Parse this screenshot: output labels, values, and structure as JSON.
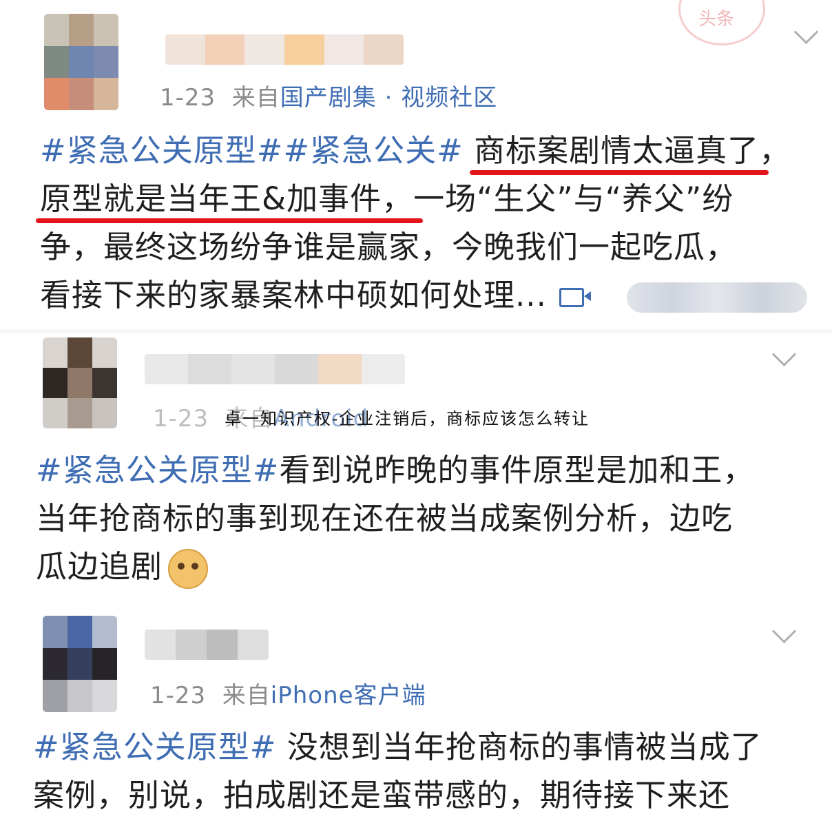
{
  "posts": [
    {
      "date": "1-23",
      "from": "来自",
      "source": "国产剧集 · 视频社区",
      "lines": {
        "l1_tag": "#紧急公关原型##紧急公关#",
        "l1_hl": "商标案剧情太逼真了",
        "l1_end": "，",
        "l2_hl": "原型就是当年王&加事件，",
        "l2_rest": "一场“生父”与“养父”纷",
        "l3": "争，最终这场纷争谁是赢家，今晚我们一起吃瓜，",
        "l4": "看接下来的家暴案林中硕如何处理..."
      },
      "video_icon": "video-camera-icon"
    },
    {
      "date": "1-23",
      "from": "来自",
      "source": "Android",
      "lines": {
        "l1_tag": "#紧急公关原型#",
        "l1_rest": "看到说昨晚的事件原型是加和王，",
        "l2": "当年抢商标的事到现在还在被当成案例分析，边吃",
        "l3": "瓜边追剧"
      },
      "emoji": "doge-emoji-icon"
    },
    {
      "date": "1-23",
      "from": "来自",
      "source": "iPhone客户端",
      "lines": {
        "l1_tag": "#紧急公关原型#",
        "l1_rest": " 没想到当年抢商标的事情被当成了",
        "l2": "案例，别说，拍成剧还是蛮带感的，期待接下来还"
      }
    }
  ],
  "watermark": "卓一知识产权-企业注销后，商标应该怎么转让",
  "stamp_text": "头条",
  "colors": {
    "link": "#3f6db3",
    "underline": "#e3141a",
    "meta": "#8a8a8a"
  }
}
